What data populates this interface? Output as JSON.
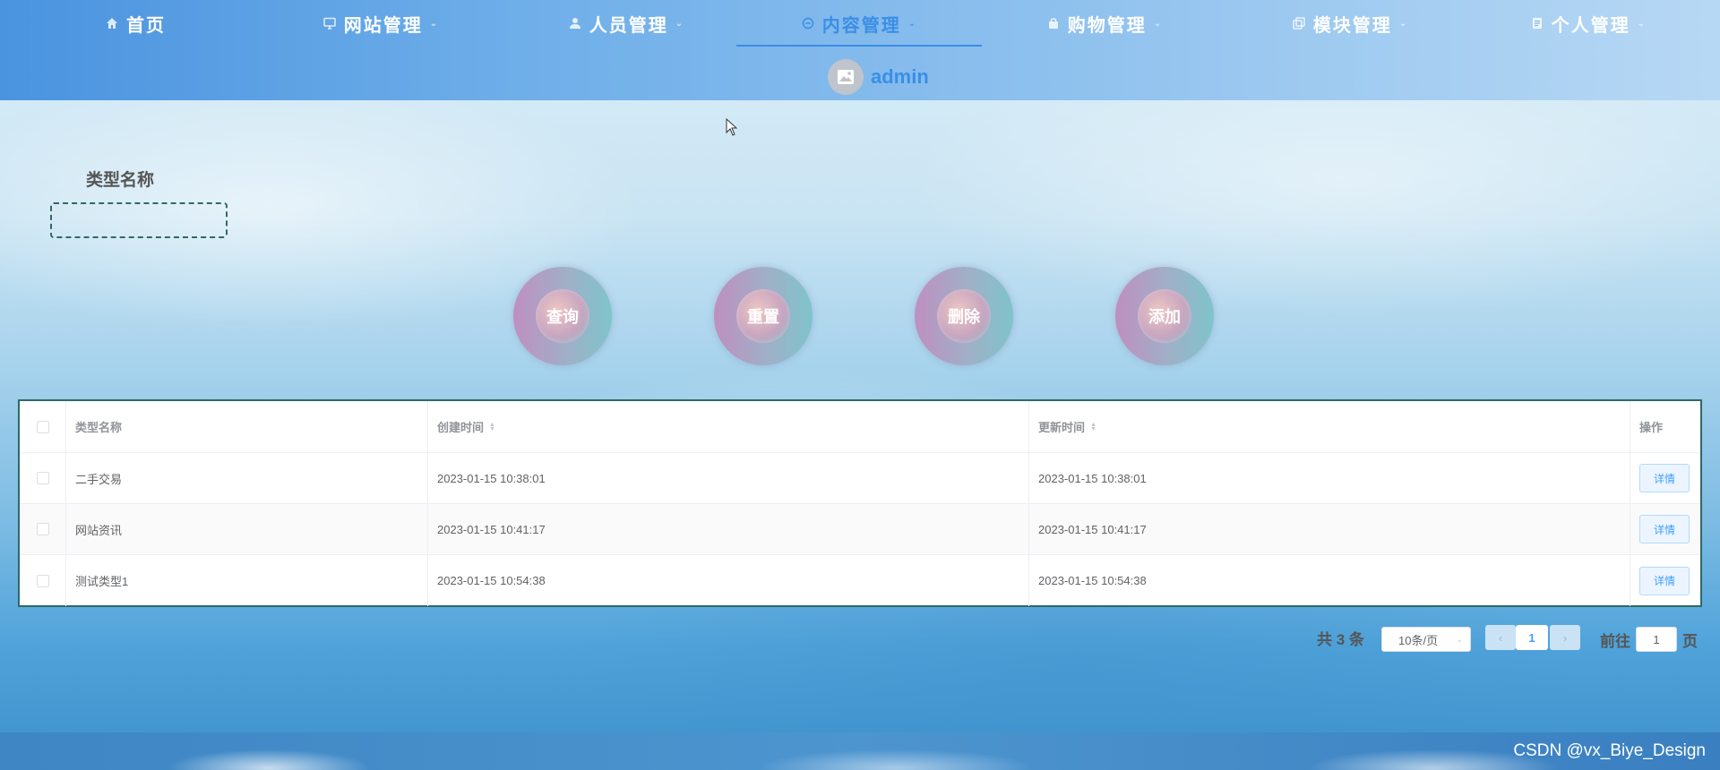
{
  "nav": {
    "items": [
      {
        "label": "首页",
        "icon": "home-icon",
        "caret": false,
        "active": false
      },
      {
        "label": "网站管理",
        "icon": "monitor-icon",
        "caret": true,
        "active": false
      },
      {
        "label": "人员管理",
        "icon": "user-icon",
        "caret": true,
        "active": false
      },
      {
        "label": "内容管理",
        "icon": "chat-icon",
        "caret": true,
        "active": true
      },
      {
        "label": "购物管理",
        "icon": "bag-icon",
        "caret": true,
        "active": false
      },
      {
        "label": "模块管理",
        "icon": "copy-icon",
        "caret": true,
        "active": false
      },
      {
        "label": "个人管理",
        "icon": "document-icon",
        "caret": true,
        "active": false
      }
    ]
  },
  "user": {
    "name": "admin"
  },
  "search": {
    "label": "类型名称",
    "value": ""
  },
  "actions": {
    "query": "查询",
    "reset": "重置",
    "delete": "删除",
    "add": "添加"
  },
  "table": {
    "columns": [
      "类型名称",
      "创建时间",
      "更新时间",
      "操作"
    ],
    "rows": [
      {
        "name": "二手交易",
        "created": "2023-01-15 10:38:01",
        "updated": "2023-01-15 10:38:01",
        "action": "详情"
      },
      {
        "name": "网站资讯",
        "created": "2023-01-15 10:41:17",
        "updated": "2023-01-15 10:41:17",
        "action": "详情"
      },
      {
        "name": "测试类型1",
        "created": "2023-01-15 10:54:38",
        "updated": "2023-01-15 10:54:38",
        "action": "详情"
      }
    ]
  },
  "pagination": {
    "total": "共 3 条",
    "page_size": "10条/页",
    "current_page": "1",
    "goto_label": "前往",
    "goto_value": "1",
    "page_unit": "页"
  },
  "footer": {
    "watermark": "CSDN @vx_Biye_Design"
  },
  "colors": {
    "accent": "#3a8ee6",
    "border_teal": "#2f6a64",
    "detail_button": "#409eff"
  }
}
